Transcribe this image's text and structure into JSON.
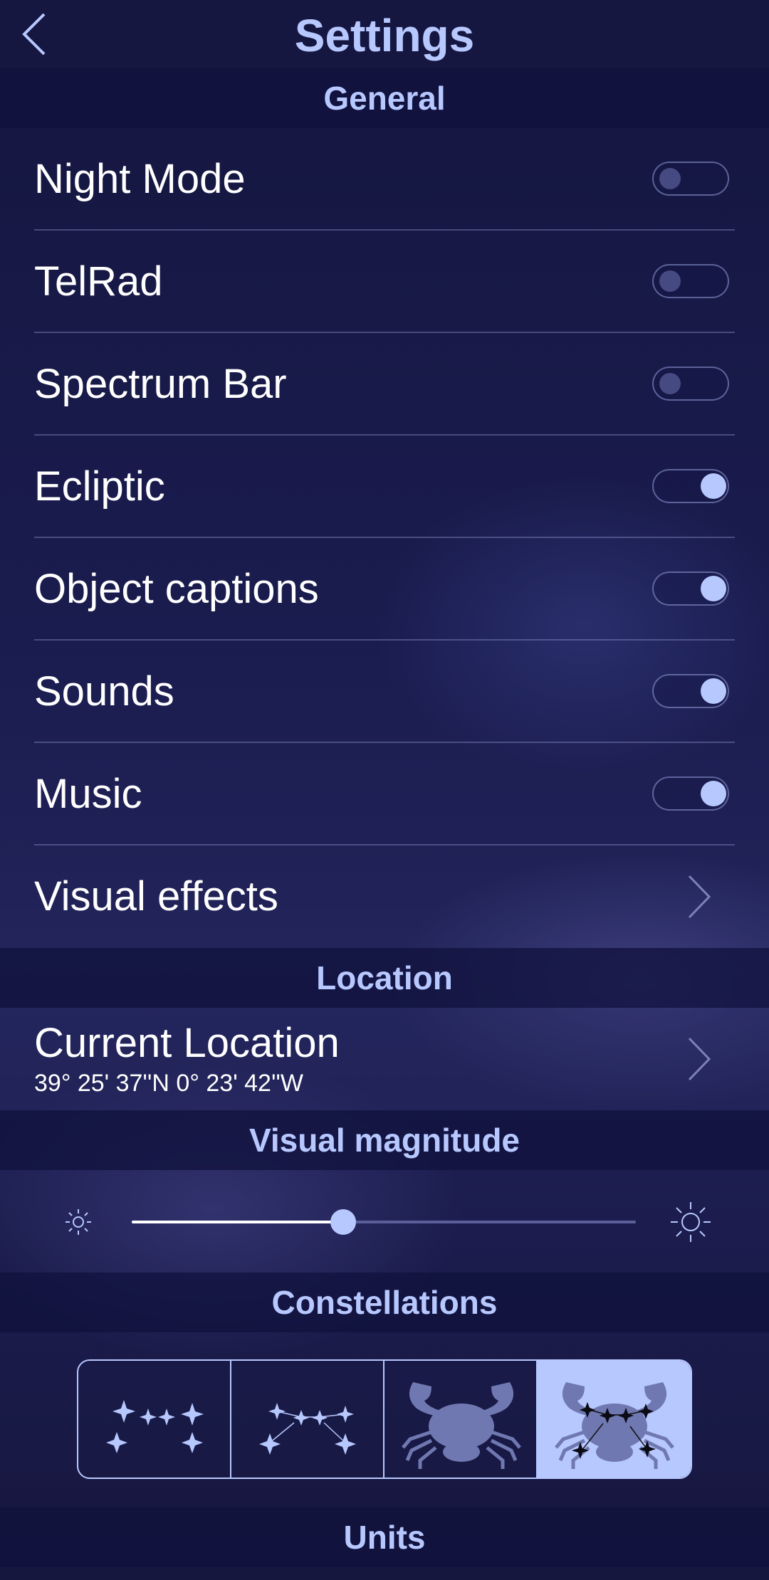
{
  "header": {
    "title": "Settings",
    "back_icon": "chevron-left-icon"
  },
  "sections": {
    "general": "General",
    "location": "Location",
    "visual_magnitude": "Visual magnitude",
    "constellations": "Constellations",
    "units": "Units"
  },
  "general_items": [
    {
      "label": "Night Mode",
      "control": "toggle",
      "on": false
    },
    {
      "label": "TelRad",
      "control": "toggle",
      "on": false
    },
    {
      "label": "Spectrum Bar",
      "control": "toggle",
      "on": false
    },
    {
      "label": "Ecliptic",
      "control": "toggle",
      "on": true
    },
    {
      "label": "Object captions",
      "control": "toggle",
      "on": true
    },
    {
      "label": "Sounds",
      "control": "toggle",
      "on": true
    },
    {
      "label": "Music",
      "control": "toggle",
      "on": true
    },
    {
      "label": "Visual effects",
      "control": "chevron"
    }
  ],
  "location": {
    "title": "Current Location",
    "coords": "39° 25' 37''N 0° 23' 42''W"
  },
  "visual_magnitude": {
    "value_fraction": 0.42,
    "min_icon": "sun-small-icon",
    "max_icon": "sun-large-icon"
  },
  "constellations": {
    "options": [
      "stars-only-icon",
      "stars-lines-icon",
      "figure-icon",
      "figure-stars-icon"
    ],
    "selected_index": 3
  },
  "colors": {
    "accent": "#b7c8ff",
    "background": "#1a1c4f",
    "header_band": "#10113c"
  }
}
